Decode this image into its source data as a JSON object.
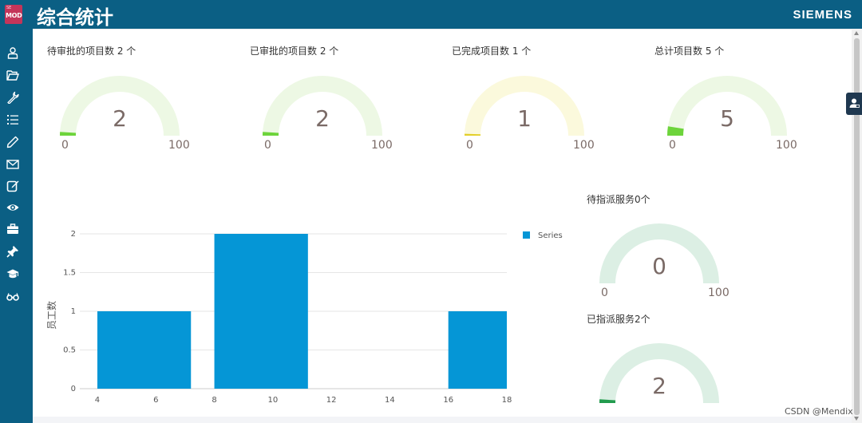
{
  "app": {
    "logo_small": "SE",
    "logo_main": "MOD",
    "title": "综合统计",
    "brand": "SIEMENS"
  },
  "sidebar": {
    "items": [
      {
        "icon": "user-icon"
      },
      {
        "icon": "folder-open-icon"
      },
      {
        "icon": "wrench-icon"
      },
      {
        "icon": "list-icon"
      },
      {
        "icon": "pencil-icon"
      },
      {
        "icon": "envelope-icon"
      },
      {
        "icon": "edit-square-icon"
      },
      {
        "icon": "eye-icon"
      },
      {
        "icon": "briefcase-icon"
      },
      {
        "icon": "pin-icon"
      },
      {
        "icon": "graduation-cap-icon"
      },
      {
        "icon": "glasses-icon"
      }
    ]
  },
  "gauges": [
    {
      "title": "待审批的项目数 2 个",
      "value": "2",
      "min": "0",
      "max": "100",
      "fraction": 0.02,
      "track_color": "#edf8e4",
      "fill_color": "#6dd43b"
    },
    {
      "title": "已审批的项目数 2 个",
      "value": "2",
      "min": "0",
      "max": "100",
      "fraction": 0.02,
      "track_color": "#edf8e4",
      "fill_color": "#6dd43b"
    },
    {
      "title": "已完成项目数 1 个",
      "value": "1",
      "min": "0",
      "max": "100",
      "fraction": 0.01,
      "track_color": "#fbf9dc",
      "fill_color": "#e3cf2a"
    },
    {
      "title": "总计项目数 5 个",
      "value": "5",
      "min": "0",
      "max": "100",
      "fraction": 0.05,
      "track_color": "#edf8e4",
      "fill_color": "#6dd43b"
    },
    {
      "title": "待指派服务0个",
      "value": "0",
      "min": "0",
      "max": "100",
      "fraction": 0.0,
      "track_color": "#dcefe4",
      "fill_color": "#239b4e"
    },
    {
      "title": "已指派服务2个",
      "value": "2",
      "min": "",
      "max": "",
      "fraction": 0.02,
      "track_color": "#dcefe4",
      "fill_color": "#239b4e"
    }
  ],
  "chart_data": {
    "type": "bar",
    "title": "",
    "xlabel": "",
    "ylabel": "员工数",
    "x_ticks": [
      "4",
      "6",
      "8",
      "10",
      "12",
      "14",
      "16",
      "18"
    ],
    "y_ticks": [
      "0",
      "0.5",
      "1",
      "1.5",
      "2"
    ],
    "xlim": [
      3.4,
      18
    ],
    "ylim": [
      0,
      2
    ],
    "grid": true,
    "legend_position": "top-right",
    "series": [
      {
        "name": "Series",
        "color": "#0596d6",
        "bars": [
          {
            "x_start": 4,
            "x_end": 7.2,
            "value": 1
          },
          {
            "x_start": 8,
            "x_end": 11.2,
            "value": 2
          },
          {
            "x_start": 16,
            "x_end": 19.2,
            "value": 1
          }
        ]
      }
    ]
  },
  "floating_button": {
    "icon": "user-support-icon"
  },
  "watermark": "CSDN @Mendix"
}
